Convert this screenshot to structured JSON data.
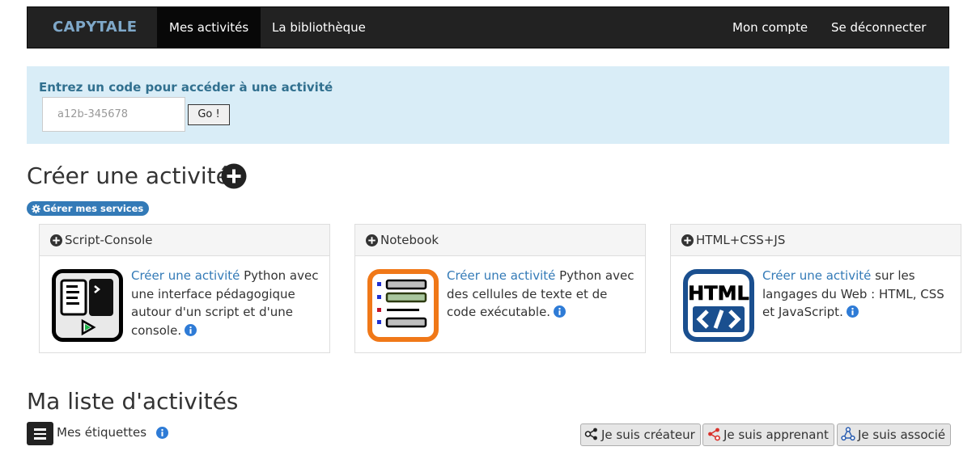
{
  "navbar": {
    "brand": "CAPYTALE",
    "items": [
      {
        "label": "Mes activités",
        "active": true
      },
      {
        "label": "La bibliothèque",
        "active": false
      }
    ],
    "right_items": [
      {
        "label": "Mon compte"
      },
      {
        "label": "Se déconnecter"
      }
    ]
  },
  "code_panel": {
    "label": "Entrez un code pour accéder à une activité",
    "placeholder": "a12b-345678",
    "value": "",
    "go_label": "Go !"
  },
  "create": {
    "title": "Créer une activité",
    "services_badge": "Gérer mes services",
    "cards": [
      {
        "title": "Script-Console",
        "link": "Créer une activité",
        "text": " Python avec une interface pédagogique autour d'un script et d'une console.",
        "icon": "script-console-icon"
      },
      {
        "title": "Notebook",
        "link": "Créer une activité",
        "text": " Python avec des cellules de texte et de code exécutable.",
        "icon": "notebook-icon"
      },
      {
        "title": "HTML+CSS+JS",
        "link": "Créer une activité",
        "text": " sur les langages du Web : HTML, CSS et JavaScript.",
        "icon": "html-icon"
      }
    ]
  },
  "list": {
    "title": "Ma liste d'activités",
    "tags_label": "Mes étiquettes",
    "roles": [
      {
        "label": "Je suis créateur",
        "color": "#222222"
      },
      {
        "label": "Je suis apprenant",
        "color": "#d9312a"
      },
      {
        "label": "Je suis associé",
        "color": "#2a5db0"
      }
    ]
  },
  "colors": {
    "navbar_bg": "#222222",
    "brand": "#7fa8c9",
    "panel_bg": "#d9edf7",
    "panel_text": "#31708f",
    "link": "#337ab7",
    "info": "#2e7bd6"
  },
  "html_icon_text": "HTML"
}
